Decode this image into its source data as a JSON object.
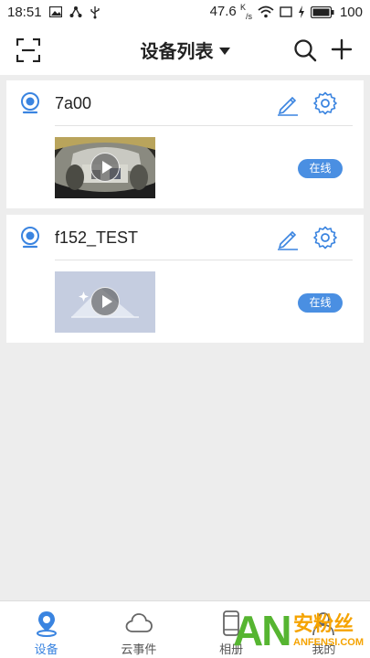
{
  "status_bar": {
    "time": "18:51",
    "network_speed": "47.6",
    "network_unit_top": "K",
    "network_unit_bottom": "/s",
    "battery": "100",
    "icons": [
      "image-icon",
      "share-icon",
      "usb-icon",
      "wifi-icon",
      "screen-icon",
      "charging-icon",
      "battery-icon"
    ]
  },
  "header": {
    "title": "设备列表",
    "icons": [
      "scan-icon",
      "dropdown-caret-icon",
      "search-icon",
      "add-icon"
    ]
  },
  "devices": [
    {
      "name": "7a00",
      "status": "在线",
      "thumbnail": "camera-snapshot"
    },
    {
      "name": "f152_TEST",
      "status": "在线",
      "thumbnail": "placeholder-image"
    }
  ],
  "tabs": [
    {
      "label": "设备",
      "icon": "device-location-icon",
      "active": true
    },
    {
      "label": "云事件",
      "icon": "cloud-icon",
      "active": false
    },
    {
      "label": "相册",
      "icon": "phone-album-icon",
      "active": false
    },
    {
      "label": "我的",
      "icon": "profile-icon",
      "active": false
    }
  ],
  "watermark": {
    "brand": "AN",
    "cn": "安粉丝",
    "url": "ANFENSI.COM"
  },
  "colors": {
    "accent": "#3a84e0",
    "badge": "#4a8fe2",
    "background": "#ededed",
    "watermark_green": "#56b531",
    "watermark_orange": "#f5a300"
  }
}
